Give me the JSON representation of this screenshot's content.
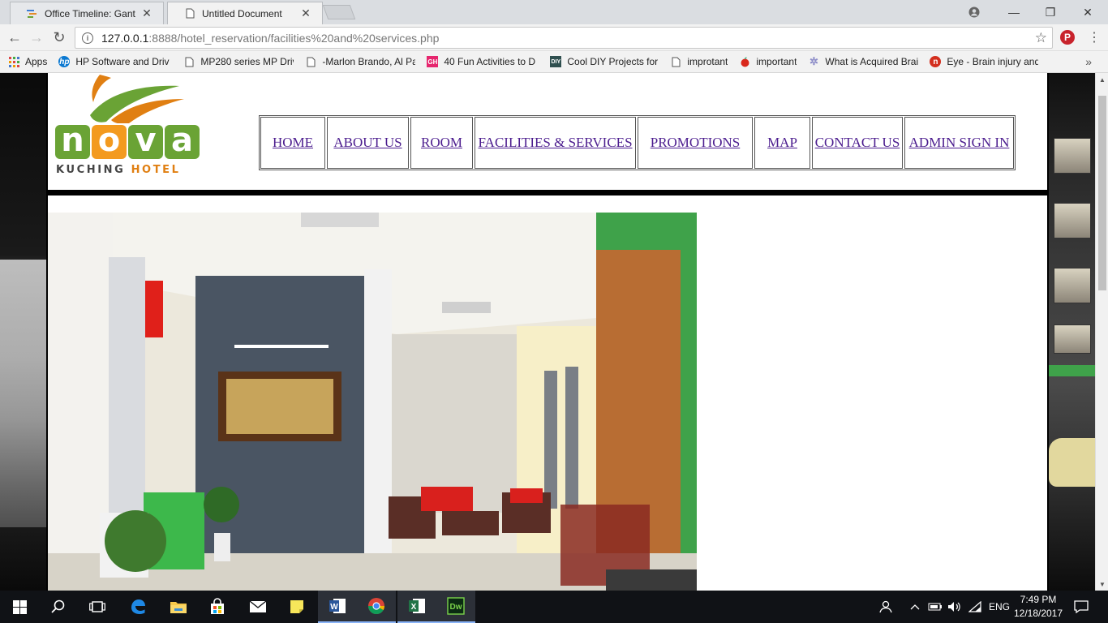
{
  "browser": {
    "tabs": [
      {
        "title": "Office Timeline: Gantt Ch",
        "icon": "gantt-icon"
      },
      {
        "title": "Untitled Document",
        "icon": "page-icon"
      }
    ],
    "active_tab": 1,
    "address": {
      "host": "127.0.0.1",
      "path": ":8888/hotel_reservation/facilities%20and%20services.php"
    },
    "bookmarks": [
      {
        "label": "Apps",
        "icon": "apps-grid-icon"
      },
      {
        "label": "HP Software and Driv",
        "icon": "hp-icon"
      },
      {
        "label": "MP280 series MP Driv",
        "icon": "page-icon"
      },
      {
        "label": "-Marlon Brando, Al Pa",
        "icon": "page-icon"
      },
      {
        "label": "40 Fun Activities to D",
        "icon": "gh-icon"
      },
      {
        "label": "Cool DIY Projects for",
        "icon": "diy-icon"
      },
      {
        "label": "improtant",
        "icon": "page-icon"
      },
      {
        "label": "important",
        "icon": "apple-icon"
      },
      {
        "label": "What is Acquired Brai",
        "icon": "gear-icon"
      },
      {
        "label": "Eye - Brain injury and",
        "icon": "n-icon"
      }
    ]
  },
  "site": {
    "logo": {
      "letters": [
        "n",
        "o",
        "v",
        "a"
      ],
      "sub_main": "KUCHING",
      "sub_accent": "HOTEL"
    },
    "nav": [
      {
        "label": "HOME"
      },
      {
        "label": "ABOUT US"
      },
      {
        "label": "ROOM"
      },
      {
        "label": "FACILITIES & SERVICES"
      },
      {
        "label": "PROMOTIONS"
      },
      {
        "label": "MAP"
      },
      {
        "label": "CONTACT US"
      },
      {
        "label": "ADMIN SIGN IN"
      }
    ]
  },
  "taskbar": {
    "apps": [
      "start-icon",
      "search-icon",
      "task-view-icon",
      "edge-icon",
      "file-explorer-icon",
      "store-icon",
      "mail-icon",
      "sticky-notes-icon",
      "word-icon",
      "chrome-icon",
      "excel-icon",
      "dreamweaver-icon"
    ],
    "language": "ENG",
    "time": "7:49 PM",
    "date": "12/18/2017"
  }
}
